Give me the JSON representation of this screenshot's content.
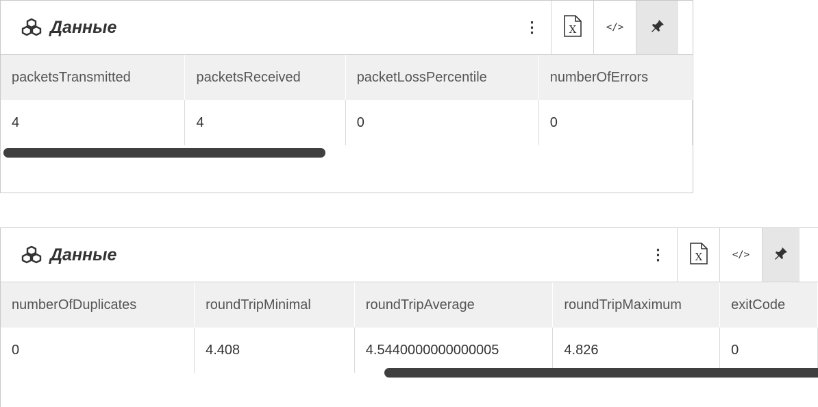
{
  "panels": [
    {
      "title": "Данные",
      "columns": [
        "packetsTransmitted",
        "packetsReceived",
        "packetLossPercentile",
        "numberOfErrors"
      ],
      "rows": [
        [
          "4",
          "4",
          "0",
          "0"
        ]
      ]
    },
    {
      "title": "Данные",
      "columns": [
        "numberOfDuplicates",
        "roundTripMinimal",
        "roundTripAverage",
        "roundTripMaximum",
        "exitCode"
      ],
      "rows": [
        [
          "0",
          "4.408",
          "4.5440000000000005",
          "4.826",
          "0"
        ]
      ]
    }
  ],
  "toolbar": {
    "menu_icon": "vertical-dots-icon",
    "excel_icon": "excel-export-icon",
    "excel_glyph": "X",
    "code_icon": "code-icon",
    "code_glyph": "</>",
    "pin_icon": "pin-icon",
    "pin_glyph": "📌",
    "menu_glyph": "⋮"
  },
  "colors": {
    "header_bg": "#f0f0f0",
    "scrollbar": "#3f3f3f",
    "pinned_bg": "#e6e6e6",
    "border": "#c8c8c8"
  }
}
